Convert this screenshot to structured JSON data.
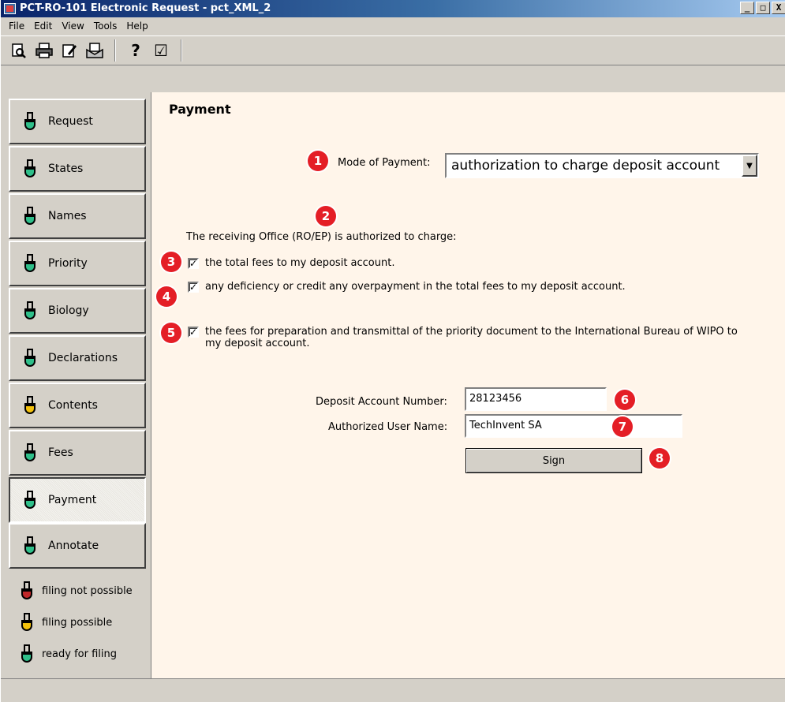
{
  "window": {
    "title": "PCT-RO-101 Electronic Request - pct_XML_2",
    "controls": [
      "_",
      "□",
      "X"
    ]
  },
  "menu": [
    "File",
    "Edit",
    "View",
    "Tools",
    "Help"
  ],
  "toolbar": {
    "icons": [
      "print-preview-icon",
      "printer-icon",
      "edit-document-icon",
      "send-mail-icon",
      "help-icon",
      "validate-check-icon"
    ],
    "help_glyph": "?",
    "validate_glyph": "☑"
  },
  "nav": {
    "items": [
      {
        "label": "Request",
        "status": "green"
      },
      {
        "label": "States",
        "status": "green"
      },
      {
        "label": "Names",
        "status": "green"
      },
      {
        "label": "Priority",
        "status": "green"
      },
      {
        "label": "Biology",
        "status": "green"
      },
      {
        "label": "Declarations",
        "status": "green"
      },
      {
        "label": "Contents",
        "status": "yellow"
      },
      {
        "label": "Fees",
        "status": "green"
      },
      {
        "label": "Payment",
        "status": "green",
        "active": true
      },
      {
        "label": "Annotate",
        "status": "green"
      }
    ],
    "legend": [
      {
        "label": "filing not possible",
        "status": "red"
      },
      {
        "label": "filing possible",
        "status": "yellow"
      },
      {
        "label": "ready for filing",
        "status": "green"
      }
    ]
  },
  "payment": {
    "title": "Payment",
    "mode_label": "Mode of Payment:",
    "mode_value": "authorization to charge deposit account",
    "authorized_text": "The receiving Office (RO/EP) is authorized to charge:",
    "checks": [
      {
        "checked": true,
        "text": "the total fees to my deposit account."
      },
      {
        "checked": true,
        "text": "any deficiency or credit any overpayment in the total fees to my deposit account."
      },
      {
        "checked": true,
        "text": "the fees for preparation and transmittal of the priority document to the International Bureau of WIPO to my deposit account."
      }
    ],
    "deposit_label": "Deposit Account Number:",
    "deposit_value": "28123456",
    "user_label": "Authorized User Name:",
    "user_value": "TechInvent SA",
    "sign_label": "Sign"
  },
  "markers": [
    "1",
    "2",
    "3",
    "4",
    "5",
    "6",
    "7",
    "8"
  ],
  "colors": {
    "marker": "#e41e26",
    "content_bg": "#fff5ea",
    "ready": "#2fbf8a",
    "possible": "#f4c20d",
    "not_possible": "#c0282a"
  }
}
